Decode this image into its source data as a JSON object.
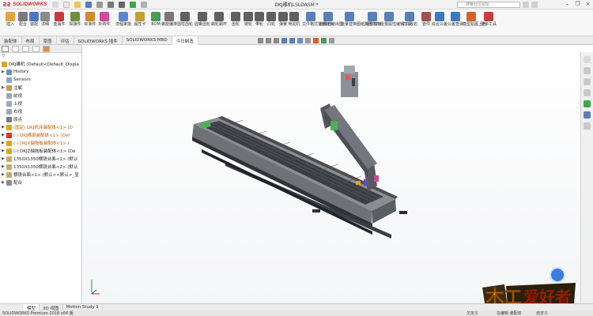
{
  "app": {
    "logo": "SOLIDWORKS",
    "document_title": "DKJ雕机LSLDASM *",
    "search_placeholder": "搜索社区论坛"
  },
  "ribbon": {
    "items": [
      {
        "label": "插入",
        "icon": "insert-component-icon",
        "color": "#e0a53c"
      },
      {
        "label": "配合",
        "icon": "mate-icon",
        "color": "#7a7a7a"
      },
      {
        "label": "装配",
        "icon": "linear-pattern-icon",
        "color": "#4b76c2"
      },
      {
        "label": "详细",
        "icon": "smart-fasteners-icon",
        "color": "#8a8a8a"
      },
      {
        "label": "金属件",
        "icon": "sheet-metal-icon",
        "color": "#c43b3b"
      },
      {
        "label": "焊接件",
        "icon": "weldments-icon",
        "color": "#6f8f3a"
      },
      {
        "label": "标准件",
        "icon": "toolbox-icon",
        "color": "#d08a2a"
      },
      {
        "label": "外购件",
        "icon": "purchased-part-icon",
        "color": "#d04a9a"
      },
      {
        "label": "流程审批",
        "icon": "workflow-icon",
        "color": "#5b87c9"
      },
      {
        "label": "属性卡",
        "icon": "property-card-icon",
        "color": "#c0a030"
      },
      {
        "label": "BOM",
        "icon": "bom-icon",
        "color": "#4a9a5a"
      },
      {
        "label": "螺旋编排",
        "icon": "spiral-icon",
        "color": "#777777"
      },
      {
        "label": "圆柱齿轮",
        "icon": "spur-gear-icon",
        "color": "#606060"
      },
      {
        "label": "圆锥齿轮",
        "icon": "bevel-gear-icon",
        "color": "#606060"
      },
      {
        "label": "蜗轮蜗杆",
        "icon": "worm-gear-icon",
        "color": "#606060"
      },
      {
        "label": "齿轮",
        "icon": "gear-icon",
        "color": "#606060"
      },
      {
        "label": "链轮",
        "icon": "sprocket-icon",
        "color": "#606060"
      },
      {
        "label": "带轮",
        "icon": "pulley-icon",
        "color": "#606060"
      },
      {
        "label": "凸轮",
        "icon": "cam-icon",
        "color": "#606060"
      },
      {
        "label": "弹簧",
        "icon": "spring-icon",
        "color": "#606060"
      },
      {
        "label": "电动机",
        "icon": "motor-icon",
        "color": "#606060"
      },
      {
        "label": "文件格式批量转换",
        "icon": "file-convert-icon",
        "color": "#5a7fb5"
      },
      {
        "label": "批量自动出图",
        "icon": "batch-drawing-icon",
        "color": "#5a7fb5"
      },
      {
        "label": "批量替换图纸/零件模板",
        "icon": "replace-template-icon",
        "color": "#5a7fb5"
      },
      {
        "label": "拆图打印",
        "icon": "split-print-icon",
        "color": "#5a7fb5"
      },
      {
        "label": "批量属性编辑工具",
        "icon": "batch-property-icon",
        "color": "#5a7fb5"
      },
      {
        "label": "文件改名",
        "icon": "rename-icon",
        "color": "#5a7fb5"
      },
      {
        "label": "管件",
        "icon": "pipe-icon",
        "color": "#a05050"
      },
      {
        "label": "综合公差",
        "icon": "tolerance-icon",
        "color": "#3d7ab8"
      },
      {
        "label": "公差查询",
        "icon": "tolerance-query-icon",
        "color": "#3d7ab8"
      },
      {
        "label": "模型贴图上色",
        "icon": "texture-color-icon",
        "color": "#d0622a"
      },
      {
        "label": "更多工具",
        "icon": "more-tools-icon",
        "color": "#c04040"
      }
    ]
  },
  "tabs": [
    {
      "label": "装配体",
      "active": false
    },
    {
      "label": "布局",
      "active": false
    },
    {
      "label": "草图",
      "active": false
    },
    {
      "label": "评估",
      "active": false
    },
    {
      "label": "SOLIDWORKS 插件",
      "active": false
    },
    {
      "label": "SOLIDWORKS MBD",
      "active": false
    },
    {
      "label": "今日制造",
      "active": true
    }
  ],
  "tree": {
    "root": "DKJ雕机 (Default<Default_Displa",
    "items": [
      {
        "label": "History",
        "icon": "history-icon",
        "color": "#6a8fc0",
        "expander": "▶",
        "warn": false
      },
      {
        "label": "Sensors",
        "icon": "sensor-icon",
        "color": "#8fa6c8",
        "expander": "",
        "warn": false
      },
      {
        "label": "注解",
        "icon": "annotation-icon",
        "color": "#b9a24a",
        "expander": "▶",
        "warn": false
      },
      {
        "label": "前视",
        "icon": "plane-icon",
        "color": "#9aa7b8",
        "expander": "",
        "warn": false
      },
      {
        "label": "上视",
        "icon": "plane-icon",
        "color": "#9aa7b8",
        "expander": "",
        "warn": false
      },
      {
        "label": "右视",
        "icon": "plane-icon",
        "color": "#9aa7b8",
        "expander": "",
        "warn": false
      },
      {
        "label": "原点",
        "icon": "origin-icon",
        "color": "#7a7a7a",
        "expander": "",
        "warn": false
      },
      {
        "label": "(固定) DKJ机床装配体<1> (D",
        "icon": "subassembly-warning-icon",
        "color": "#d9a520",
        "expander": "▶",
        "warn": true
      },
      {
        "label": "(-) DKJ横梁装配体<1> (Def",
        "icon": "subassembly-error-icon",
        "color": "#c83a2a",
        "expander": "▶",
        "warn": true
      },
      {
        "label": "(-) DKJX轴拖板装配体<1> (",
        "icon": "subassembly-warning-icon",
        "color": "#d9a520",
        "expander": "▶",
        "warn": true
      },
      {
        "label": "(-) DKJZ轴拖板装配体<1> (De",
        "icon": "subassembly-warning-icon",
        "color": "#d9a520",
        "expander": "▶",
        "warn": false
      },
      {
        "label": "1350X1350横铁台面<1> (默认",
        "icon": "part-icon",
        "color": "#c7a96b",
        "expander": "▶",
        "warn": false
      },
      {
        "label": "1350X1350横铁台面<2> (默认",
        "icon": "part-icon",
        "color": "#c7a96b",
        "expander": "▶",
        "warn": false
      },
      {
        "label": "横铁台面<1> (默认<<默认>_显",
        "icon": "part-icon",
        "color": "#c7a96b",
        "expander": "▶",
        "warn": false
      },
      {
        "label": "配合",
        "icon": "mates-folder-icon",
        "color": "#8a8a8a",
        "expander": "▶",
        "warn": false
      }
    ]
  },
  "bottom_tabs": [
    {
      "label": "模型",
      "active": true
    },
    {
      "label": "3D 视图",
      "active": false
    },
    {
      "label": "Motion Study 1",
      "active": false
    }
  ],
  "status": {
    "app_version": "SOLIDWORKS Premium 2018 x64 版",
    "state": "欠定义",
    "mode": "在编辑 装配体",
    "units": "自定义"
  },
  "watermark": {
    "text": "木工爱好者"
  }
}
